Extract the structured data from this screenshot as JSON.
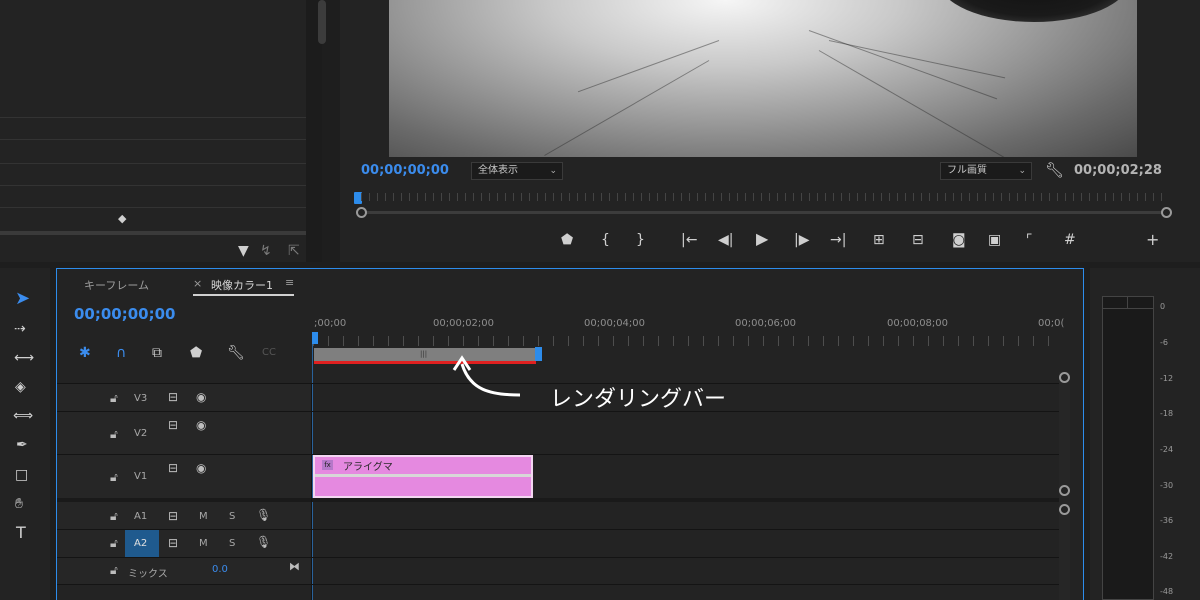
{
  "program": {
    "current_tc": "00;00;00;00",
    "zoom": "全体表示",
    "quality": "フル画質",
    "duration_tc": "00;00;02;28"
  },
  "timeline": {
    "tabs": {
      "keyframe": "キーフレーム",
      "sequence": "映像カラー1",
      "close": "×",
      "menu": "≡"
    },
    "timecode": "00;00;00;00",
    "ruler": [
      ";00;00",
      "00;00;02;00",
      "00;00;04;00",
      "00;00;06;00",
      "00;00;08;00",
      "00;0("
    ],
    "tracks": {
      "v3": "V3",
      "v2": "V2",
      "v1": "V1",
      "a1": "A1",
      "a2": "A2",
      "mix": "ミックス",
      "mix_value": "0.0",
      "m": "M",
      "s": "S"
    },
    "clip": {
      "fx": "fx",
      "name": "アライグマ"
    },
    "annotation": "レンダリングバー"
  },
  "meters": {
    "scale": [
      "0",
      "-6",
      "-12",
      "-18",
      "-24",
      "-30",
      "-36",
      "-42",
      "-48"
    ]
  },
  "colors": {
    "accent": "#2d8ceb",
    "clip": "#e589e0",
    "render_bar": "#e02020"
  }
}
